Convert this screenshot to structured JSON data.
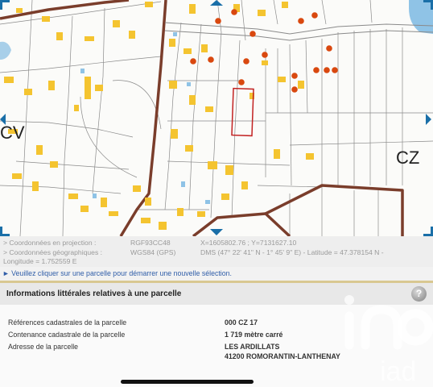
{
  "map": {
    "section_labels": [
      "CV",
      "CZ"
    ],
    "colors": {
      "roads": "#7a3d2b",
      "parcel_lines": "#7a7a7a",
      "buildings": "#f4c430",
      "water": "#8fc3e6",
      "selection": "#c22222",
      "points": "#d9480f",
      "nav_arrows": "#1a6fa8"
    }
  },
  "coords": {
    "projection_label": "> Coordonnées en projection :",
    "projection_system": "RGF93CC48",
    "projection_values": "X=1605802.76 ; Y=7131627.10",
    "geo_label": "> Coordonnées géographiques :",
    "geo_system": "WGS84 (GPS)",
    "geo_values": "DMS (47° 22' 41\" N - 1° 45' 9\" E) - Latitude = 47.378154 N -",
    "longitude": "Longitude = 1.752559 E"
  },
  "hint": "► Veuillez cliquer sur une parcelle pour démarrer une nouvelle sélection.",
  "info": {
    "title": "Informations littérales relatives à une parcelle",
    "help_label": "?",
    "rows": [
      {
        "label": "Références cadastrales de la parcelle",
        "value": "000 CZ 17"
      },
      {
        "label": "Contenance cadastrale de la parcelle",
        "value": "1 719 mètre carré"
      },
      {
        "label": "Adresse de la parcelle",
        "value": "LES ARDILLATS",
        "value2": "41200 ROMORANTIN-LANTHENAY"
      }
    ]
  },
  "watermark": "iad"
}
